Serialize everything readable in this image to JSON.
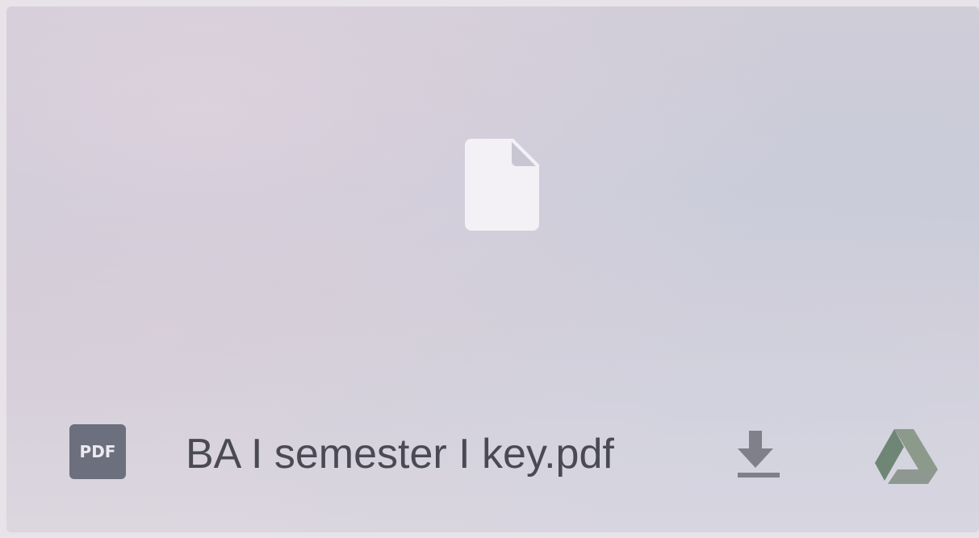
{
  "attachment": {
    "file_type_badge": "PDF",
    "file_name": "BA I semester I key.pdf",
    "preview_icon": "file-icon",
    "actions": [
      {
        "name": "download",
        "icon": "download-icon"
      },
      {
        "name": "save-to-drive",
        "icon": "drive-icon"
      }
    ]
  },
  "colors": {
    "badge_bg": "#6c6f7d",
    "text": "#4a4a55",
    "icon_gray": "#7f7f88",
    "drive_green": "#7a8f80"
  }
}
